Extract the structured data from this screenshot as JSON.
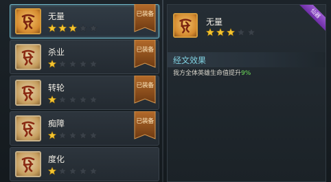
{
  "scriptures": [
    {
      "name": "无量",
      "stars": 3,
      "max_stars": 5,
      "status": "已装备",
      "equipped": true,
      "selected": true,
      "icon": "gold-rune-icon"
    },
    {
      "name": "杀业",
      "stars": 1,
      "max_stars": 5,
      "status": "已装备",
      "equipped": true,
      "selected": false,
      "icon": "tan-rune-icon"
    },
    {
      "name": "转轮",
      "stars": 1,
      "max_stars": 5,
      "status": "已装备",
      "equipped": true,
      "selected": false,
      "icon": "tan-rune-icon"
    },
    {
      "name": "痴障",
      "stars": 1,
      "max_stars": 5,
      "status": "已装备",
      "equipped": true,
      "selected": false,
      "icon": "tan-rune-icon"
    },
    {
      "name": "度化",
      "stars": 1,
      "max_stars": 5,
      "status": "",
      "equipped": false,
      "selected": false,
      "icon": "tan-rune-icon"
    }
  ],
  "detail": {
    "name": "无量",
    "stars": 3,
    "max_stars": 5,
    "corner_label": "仙器",
    "section_title": "经文效果",
    "effect_prefix": "我方全体英雄生命值提升",
    "effect_value": "9%"
  },
  "colors": {
    "star_on": "#f4c531",
    "star_off": "#3a4149",
    "accent": "#7fd0e0",
    "highlight": "#6fe05a"
  }
}
